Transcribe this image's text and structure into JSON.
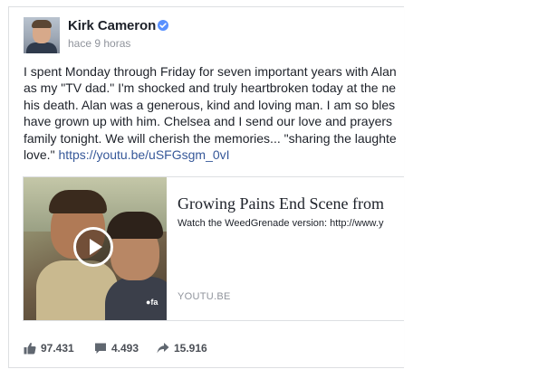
{
  "post": {
    "author": "Kirk Cameron",
    "timestamp": "hace 9 horas",
    "text_lines": [
      "I spent Monday through Friday for seven important years with Alan",
      "as my \"TV dad.\" I'm shocked and truly heartbroken today at the ne",
      "his death. Alan was a generous, kind and loving man. I am so bles",
      "have grown up with him. Chelsea and I send our love and prayers",
      "family tonight. We will cherish the memories... \"sharing the laughte"
    ],
    "last_line_text": "love.\" ",
    "link": "https://youtu.be/uSFGsgm_0vI"
  },
  "attachment": {
    "title": "Growing Pains End Scene from",
    "description": "Watch the WeedGrenade version: http://www.y",
    "domain": "YOUTU.BE",
    "thumb_logo": "●fa"
  },
  "stats": {
    "likes": "97.431",
    "comments": "4.493",
    "shares": "15.916"
  },
  "colors": {
    "text": "#1d2129",
    "link": "#365899",
    "meta": "#90949c",
    "verified": "#5890ff",
    "stat_icon": "#606770"
  }
}
